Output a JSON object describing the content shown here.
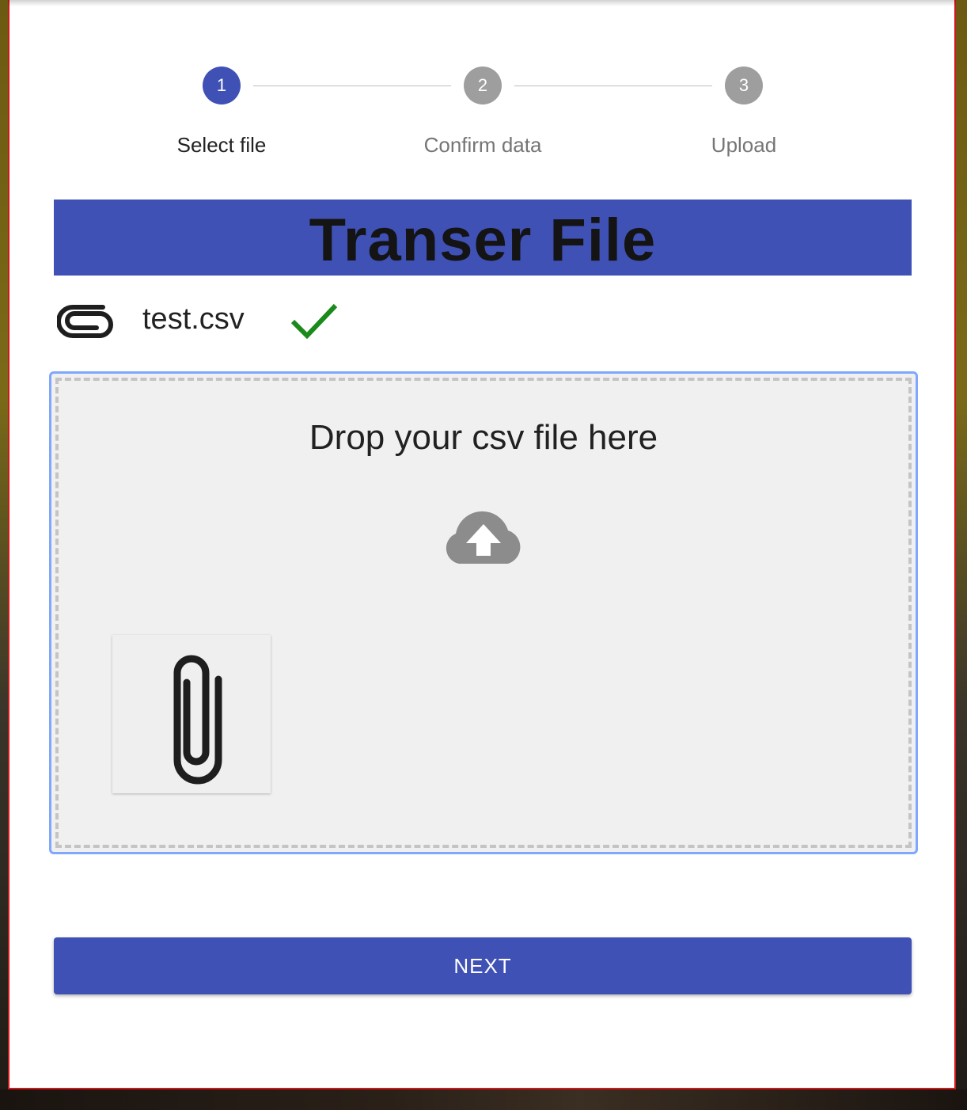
{
  "stepper": {
    "steps": [
      {
        "number": "1",
        "label": "Select file",
        "state": "active"
      },
      {
        "number": "2",
        "label": "Confirm data",
        "state": "inactive"
      },
      {
        "number": "3",
        "label": "Upload",
        "state": "inactive"
      }
    ]
  },
  "banner": {
    "title": "Transer File"
  },
  "file": {
    "name": "test.csv",
    "status_icon": "checkmark-icon",
    "icon": "paperclip-icon"
  },
  "dropzone": {
    "prompt": "Drop your csv file here",
    "icon": "cloud-upload-icon",
    "preview_icon": "paperclip-icon"
  },
  "actions": {
    "next_label": "NEXT"
  },
  "colors": {
    "primary": "#3f51b5",
    "inactive_step": "#9e9e9e",
    "success": "#1a8a1a",
    "dropzone_focus": "#7fa7ff"
  }
}
